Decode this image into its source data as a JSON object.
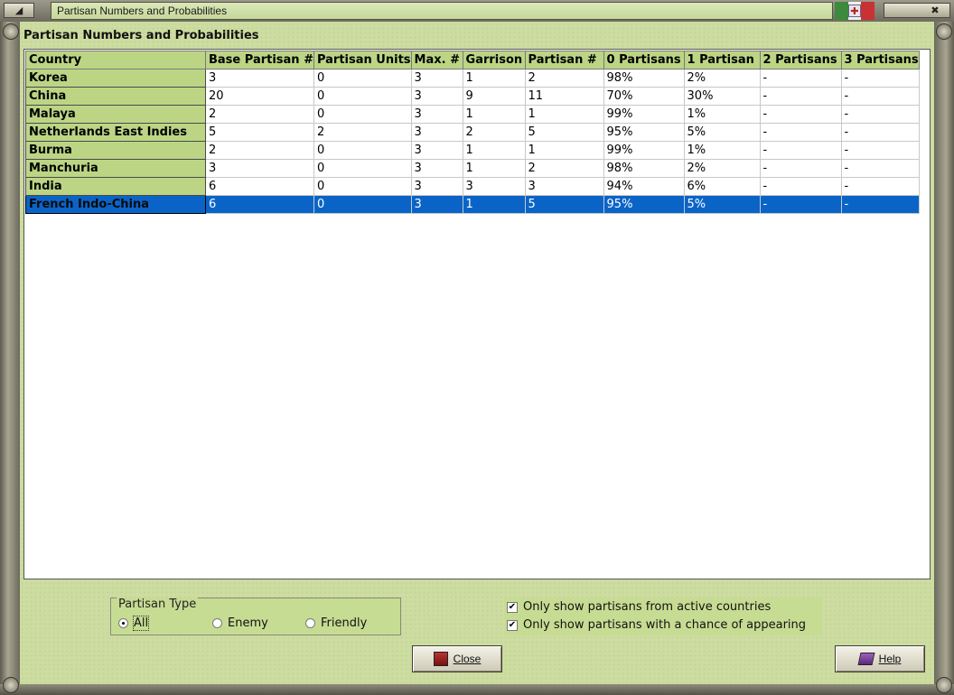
{
  "window": {
    "title": "Partisan Numbers and Probabilities",
    "left_button_icon": "restore-icon",
    "right_button_icon": "close-icon"
  },
  "panel": {
    "heading": "Partisan Numbers and Probabilities"
  },
  "table": {
    "columns": [
      "Country",
      "Base Partisan #",
      "Partisan Units",
      "Max. #",
      "Garrison",
      "Partisan #",
      "0 Partisans",
      "1 Partisan",
      "2 Partisans",
      "3 Partisans"
    ],
    "rows": [
      [
        "Korea",
        "3",
        "0",
        "3",
        "1",
        "2",
        "98%",
        "2%",
        "-",
        "-"
      ],
      [
        "China",
        "20",
        "0",
        "3",
        "9",
        "11",
        "70%",
        "30%",
        "-",
        "-"
      ],
      [
        "Malaya",
        "2",
        "0",
        "3",
        "1",
        "1",
        "99%",
        "1%",
        "-",
        "-"
      ],
      [
        "Netherlands East Indies",
        "5",
        "2",
        "3",
        "2",
        "5",
        "95%",
        "5%",
        "-",
        "-"
      ],
      [
        "Burma",
        "2",
        "0",
        "3",
        "1",
        "1",
        "99%",
        "1%",
        "-",
        "-"
      ],
      [
        "Manchuria",
        "3",
        "0",
        "3",
        "1",
        "2",
        "98%",
        "2%",
        "-",
        "-"
      ],
      [
        "India",
        "6",
        "0",
        "3",
        "3",
        "3",
        "94%",
        "6%",
        "-",
        "-"
      ],
      [
        "French Indo-China",
        "6",
        "0",
        "3",
        "1",
        "5",
        "95%",
        "5%",
        "-",
        "-"
      ]
    ],
    "selected_row": 7
  },
  "partisan_type": {
    "title": "Partisan Type",
    "options": [
      "All",
      "Enemy",
      "Friendly"
    ],
    "selected": "All"
  },
  "filters": {
    "active_countries_label": "Only show partisans from active countries",
    "active_countries_checked": true,
    "chance_label": "Only show partisans with a chance of appearing",
    "chance_checked": true
  },
  "buttons": {
    "close_label": "Close",
    "help_label": "Help"
  },
  "colors": {
    "header_green": "#bcd585",
    "selection_blue": "#0a64c8",
    "panel_green": "#cddca0"
  }
}
